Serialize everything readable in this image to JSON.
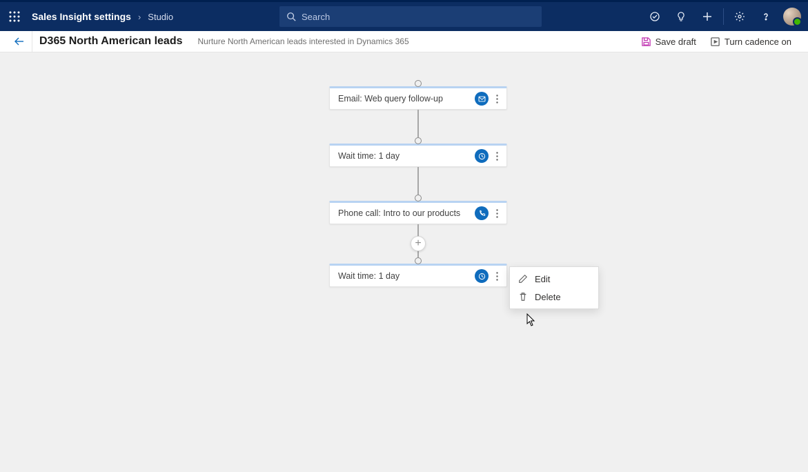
{
  "nav": {
    "crumb1": "Sales Insight settings",
    "crumb2": "Studio",
    "search_placeholder": "Search"
  },
  "sub": {
    "title": "D365 North American leads",
    "description": "Nurture North American leads interested in Dynamics 365",
    "save_label": "Save draft",
    "turn_label": "Turn cadence on"
  },
  "steps": [
    {
      "label": "Email: Web query follow-up",
      "icon": "mail"
    },
    {
      "label": "Wait time: 1 day",
      "icon": "clock"
    },
    {
      "label": "Phone call: Intro to our products",
      "icon": "phone"
    },
    {
      "label": "Wait time: 1 day",
      "icon": "clock"
    }
  ],
  "menu": {
    "edit": "Edit",
    "delete": "Delete"
  }
}
